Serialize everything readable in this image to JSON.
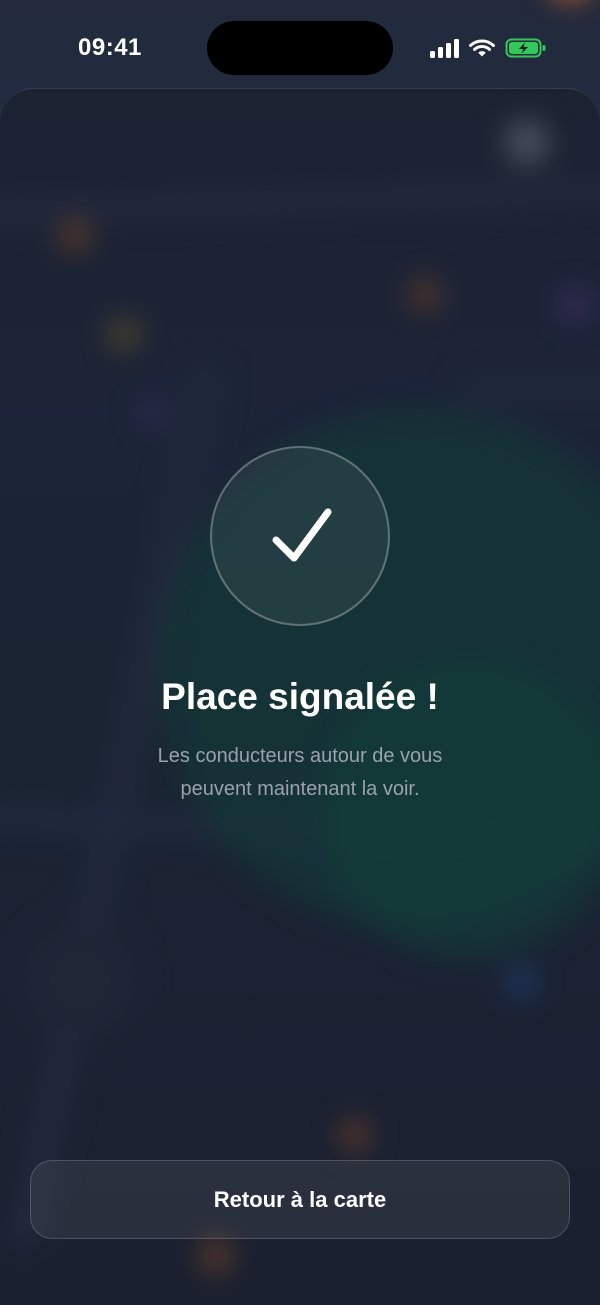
{
  "status_bar": {
    "time": "09:41",
    "icons": [
      "signal-icon",
      "wifi-icon",
      "battery-charging-icon"
    ],
    "battery_color": "#34c759"
  },
  "success": {
    "icon": "checkmark-icon",
    "title": "Place signalée !",
    "message_line1": "Les conducteurs autour de vous",
    "message_line2": "peuvent maintenant la voir."
  },
  "actions": {
    "back_label": "Retour à la carte"
  },
  "colors": {
    "background": "#1c2233",
    "accent_map_green": "#0f5b4a",
    "subtitle": "#9aa1ad"
  }
}
